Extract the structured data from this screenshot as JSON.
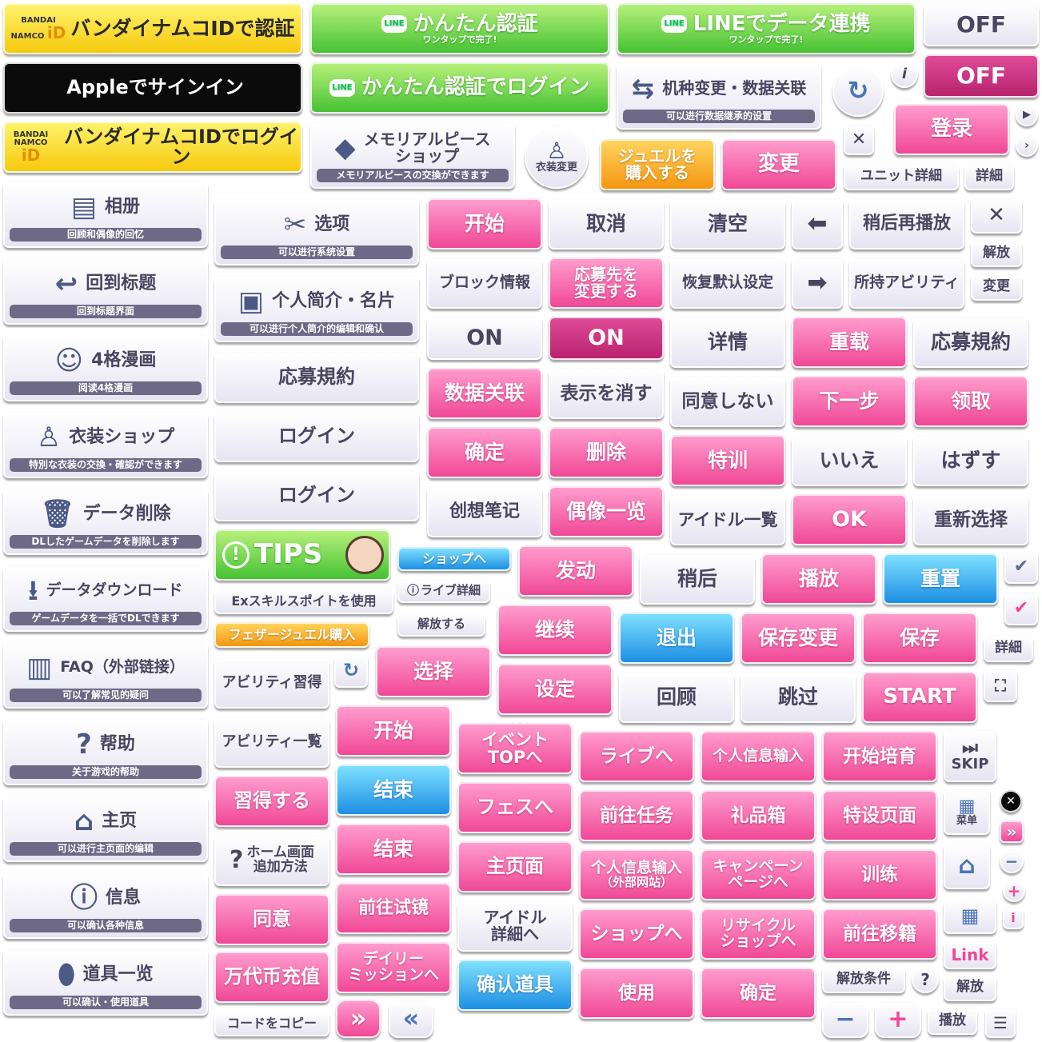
{
  "icons": {
    "line": "line-logo-icon",
    "apple": "apple-logo-icon",
    "bandai": "bandai-namco-id-logo",
    "arrow_left": "arrow-left-icon",
    "arrow_right": "arrow-right-icon",
    "close": "close-icon",
    "check": "check-icon",
    "expand": "expand-icon",
    "home": "home-icon",
    "menu": "menu-grid-icon",
    "skip": "skip-icon"
  },
  "colors": {
    "pink": "#f04896",
    "blue": "#1d8fe3",
    "green": "#45c233",
    "yellow": "#f6c90e",
    "orange": "#f49612",
    "white": "#e6e4f1"
  },
  "r1": {
    "bandai_auth": "バンダイナムコIDで認証",
    "line_auth": "かんたん認証",
    "line_auth_sub": "ワンタップで完了!",
    "line_link": "LINEでデータ連携",
    "line_link_sub": "ワンタップで完了!",
    "off1": "OFF",
    "apple_signin": "Appleでサインイン",
    "line_login": "かんたん認証でログイン",
    "device_change": "机种变更・数据关联",
    "device_change_sub": "可以进行数据继承的设置",
    "off2": "OFF",
    "bandai_login": "バンダイナムコIDでログイン",
    "memorial": "メモリアルピース\nショップ",
    "memorial_sub": "メモリアルピースの交換ができます",
    "costume_change": "衣装変更",
    "jewel_buy": "ジュエルを\n購入する",
    "change": "変更",
    "login_cn": "登录",
    "unit_detail": "ユニット詳細",
    "detail": "詳細"
  },
  "menu": [
    {
      "title": "相册",
      "sub": "回顾和偶像的回忆",
      "icon": "album-icon"
    },
    {
      "title": "回到标题",
      "sub": "回到标题界面",
      "icon": "return-icon"
    },
    {
      "title": "4格漫画",
      "sub": "阅读4格漫画",
      "icon": "comic-icon"
    },
    {
      "title": "衣装ショップ",
      "sub": "特別な衣装の交換・確認ができます",
      "icon": "costume-icon"
    },
    {
      "title": "データ削除",
      "sub": "DLしたゲームデータを削除します",
      "icon": "trash-icon"
    },
    {
      "title": "データダウンロード",
      "sub": "ゲームデータを一括でDLできます",
      "icon": "download-icon"
    },
    {
      "title": "FAQ（外部链接）",
      "sub": "可以了解常见的疑问",
      "icon": "faq-icon"
    },
    {
      "title": "帮助",
      "sub": "关于游戏的帮助",
      "icon": "help-icon"
    },
    {
      "title": "主页",
      "sub": "可以进行主页面的编辑",
      "icon": "home-edit-icon"
    },
    {
      "title": "信息",
      "sub": "可以确认各种信息",
      "icon": "info-icon"
    },
    {
      "title": "道具一览",
      "sub": "可以确认・使用道具",
      "icon": "item-icon"
    }
  ],
  "col2": {
    "options": "选项",
    "options_sub": "可以进行系统设置",
    "profile": "个人简介・名片",
    "profile_sub": "可以进行个人简介的编辑和确认",
    "rules": "応募規約",
    "login1": "ログイン",
    "login2": "ログイン",
    "tips": "TIPS",
    "shop_to": "ショップへ",
    "ex_skill": "Exスキルスポイトを使用",
    "live_detail": "ライブ詳細",
    "release": "解放する",
    "feather": "フェザージュエル購入",
    "ability_learn": "アビリティ習得",
    "ability_list": "アビリティ一覧",
    "learn": "習得する",
    "home_add": "ホーム画面\n追加方法",
    "agree": "同意",
    "charge": "万代币充值",
    "copy_code": "コードをコピー"
  },
  "grid": {
    "start": "开始",
    "cancel": "取消",
    "clear": "清空",
    "replay_later": "稍后再播放",
    "unlock": "解放",
    "block_info": "ブロック情報",
    "change_dest": "応募先を\n変更する",
    "restore": "恢复默认设定",
    "owned_ability": "所持アビリティ",
    "change2": "変更",
    "on1": "ON",
    "on2": "ON",
    "detail_cn": "详情",
    "reload": "重载",
    "rules2": "応募規約",
    "data_link": "数据关联",
    "hide": "表示を消す",
    "disagree": "同意しない",
    "next": "下一步",
    "receive": "领取",
    "confirm": "确定",
    "delete": "删除",
    "training": "特训",
    "no": "いいえ",
    "remove": "はずす",
    "notes": "创想笔记",
    "idol_list_cn": "偶像一览",
    "idol_list_jp": "アイドル一覧",
    "ok": "OK",
    "reselect": "重新选择",
    "activate": "发动",
    "later": "稍后",
    "play": "播放",
    "reset": "重置",
    "continue": "继续",
    "exit": "退出",
    "save_change": "保存变更",
    "save": "保存",
    "detail3": "詳細",
    "select": "选择",
    "settings": "设定",
    "review": "回顾",
    "skip_cn": "跳过",
    "start_en": "START"
  },
  "lower": {
    "start2": "开始",
    "end1": "结束",
    "end2": "结束",
    "try_on": "前往试镜",
    "daily": "デイリー\nミッションへ",
    "event_top": "イベント\nTOPへ",
    "fes": "フェスへ",
    "main_page": "主页面",
    "idol_detail": "アイドル\n詳細へ",
    "confirm_item": "确认道具",
    "live_to": "ライブへ",
    "personal_input": "个人信息输入",
    "start_training": "开始培育",
    "skip": "SKIP",
    "go_mission": "前往任务",
    "gift_box": "礼品箱",
    "special_page": "特设页面",
    "menu": "菜单",
    "personal_input_ext": "个人信息输入",
    "personal_input_ext_sub": "（外部网站）",
    "campaign": "キャンペーン\nページへ",
    "train": "训练",
    "shop_to2": "ショップへ",
    "recycle": "リサイクル\nショップへ",
    "transfer": "前往移籍",
    "link": "Link",
    "use": "使用",
    "confirm2": "确定",
    "unlock_cond": "解放条件",
    "unlock2": "解放",
    "play2": "播放"
  },
  "glyphs": {
    "ff": "»",
    "rw": "«",
    "minus": "−",
    "plus": "+",
    "q": "?",
    "i": "i",
    "x": "✕",
    "check": "✔",
    "tri": "▶"
  }
}
